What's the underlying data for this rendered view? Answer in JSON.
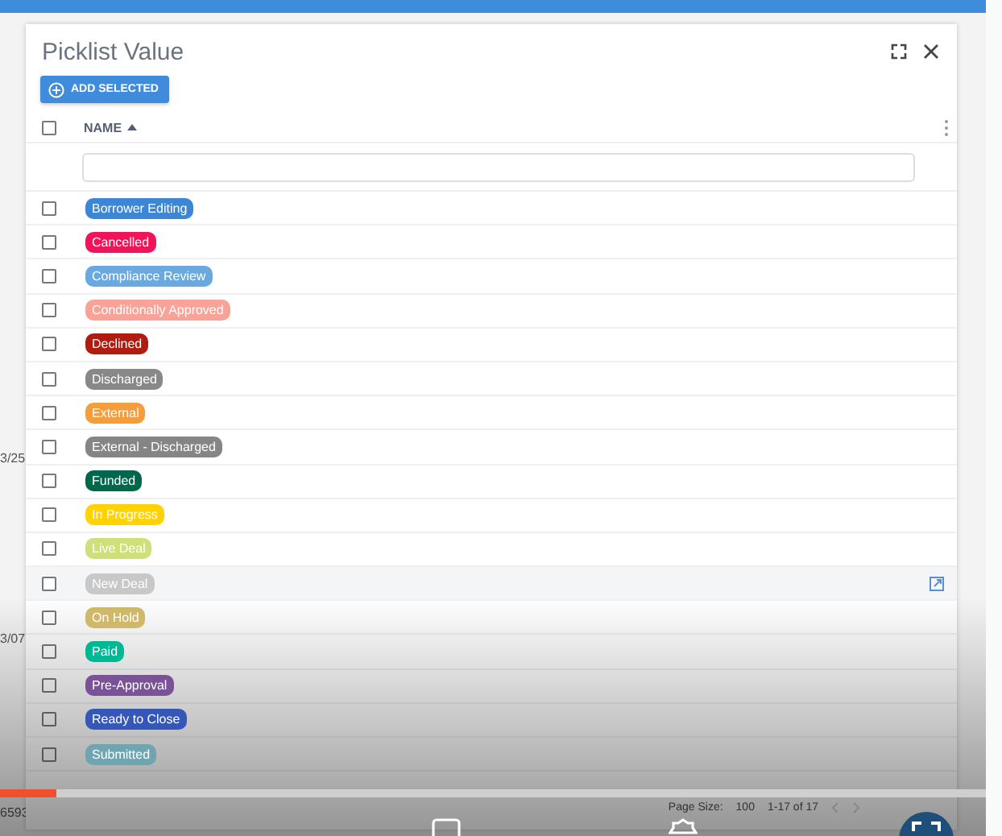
{
  "background": {
    "texts": [
      "3/25",
      "3/07",
      "6593"
    ]
  },
  "dialog": {
    "title": "Picklist Value",
    "add_button": "ADD SELECTED",
    "select_all": {
      "checked": false
    },
    "column": {
      "label": "NAME",
      "sorted_ascending": true
    },
    "rows": [
      {
        "label": "Borrower Editing",
        "color": "#3d86d6",
        "checked": false,
        "hovered": false
      },
      {
        "label": "Cancelled",
        "color": "#f0145a",
        "checked": false,
        "hovered": false
      },
      {
        "label": "Compliance Review",
        "color": "#6aa8e0",
        "checked": false,
        "hovered": false
      },
      {
        "label": "Conditionally Approved",
        "color": "#f9a297",
        "checked": false,
        "hovered": false
      },
      {
        "label": "Declined",
        "color": "#b01c10",
        "checked": false,
        "hovered": false
      },
      {
        "label": "Discharged",
        "color": "#888888",
        "checked": false,
        "hovered": false
      },
      {
        "label": "External",
        "color": "#f59c3c",
        "checked": false,
        "hovered": false
      },
      {
        "label": "External - Discharged",
        "color": "#858585",
        "checked": false,
        "hovered": false
      },
      {
        "label": "Funded",
        "color": "#00674c",
        "checked": false,
        "hovered": false
      },
      {
        "label": "In Progress",
        "color": "#ffd200",
        "checked": false,
        "hovered": false
      },
      {
        "label": "Live Deal",
        "color": "#cde07a",
        "checked": false,
        "hovered": false
      },
      {
        "label": "New Deal",
        "color": "#c8c8c8",
        "checked": false,
        "hovered": true
      },
      {
        "label": "On Hold",
        "color": "#cfb86a",
        "checked": false,
        "hovered": false
      },
      {
        "label": "Paid",
        "color": "#00b894",
        "checked": false,
        "hovered": false
      },
      {
        "label": "Pre-Approval",
        "color": "#7a5296",
        "checked": false,
        "hovered": false
      },
      {
        "label": "Ready to Close",
        "color": "#3558b8",
        "checked": false,
        "hovered": false
      },
      {
        "label": "Submitted",
        "color": "#6fa5b0",
        "checked": false,
        "hovered": false
      }
    ],
    "pagination": {
      "page_size_label": "Page Size:",
      "page_size": "100",
      "range": "1-17 of 17"
    }
  },
  "player": {
    "progress": {
      "level": 0.058
    }
  }
}
